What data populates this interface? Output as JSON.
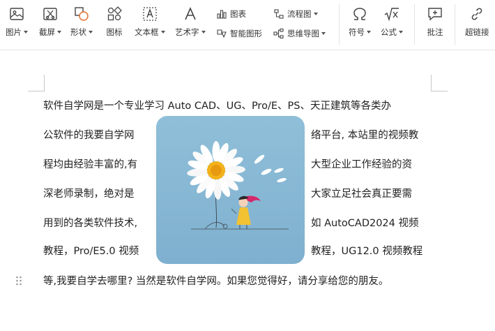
{
  "ribbon": {
    "tools": [
      {
        "id": "picture",
        "label": "图片",
        "icon": "picture-icon",
        "has_dropdown": true
      },
      {
        "id": "screenshot",
        "label": "截屏",
        "icon": "screenshot-icon",
        "has_dropdown": true
      },
      {
        "id": "shape",
        "label": "形状",
        "icon": "shape-icon",
        "has_dropdown": true
      },
      {
        "id": "icon",
        "label": "图标",
        "icon": "icon-library-icon",
        "has_dropdown": false
      },
      {
        "id": "textbox",
        "label": "文本框",
        "icon": "textbox-icon",
        "has_dropdown": true
      },
      {
        "id": "wordart",
        "label": "艺术字",
        "icon": "wordart-icon",
        "has_dropdown": true
      },
      {
        "id": "symbol",
        "label": "符号",
        "icon": "omega-icon",
        "has_dropdown": true
      },
      {
        "id": "formula",
        "label": "公式",
        "icon": "formula-icon",
        "has_dropdown": true
      },
      {
        "id": "comment",
        "label": "批注",
        "icon": "comment-icon",
        "has_dropdown": false
      },
      {
        "id": "hyperlink",
        "label": "超链接",
        "icon": "link-icon",
        "has_dropdown": false
      }
    ],
    "small_tools": [
      {
        "id": "chart",
        "label": "图表",
        "icon": "chart-icon",
        "has_dropdown": false
      },
      {
        "id": "smartart",
        "label": "智能图形",
        "icon": "smartart-icon",
        "has_dropdown": false
      },
      {
        "id": "flowchart",
        "label": "流程图",
        "icon": "flowchart-icon",
        "has_dropdown": true
      },
      {
        "id": "mindmap",
        "label": "思维导图",
        "icon": "mindmap-icon",
        "has_dropdown": true
      }
    ]
  },
  "document": {
    "line1": "软件自学网是一个专业学习 Auto CAD、UG、Pro/E、PS、天正建筑等各类办",
    "line2_left": "公软件的我要自学网",
    "line2_right": "络平台, 本站里的视频教",
    "line3_left": "程均由经验丰富的,有",
    "line3_right": "大型企业工作经验的资",
    "line4_left": "深老师录制，绝对是",
    "line4_right": "大家立足社会真正要需",
    "line5_left": "用到的各类软件技术,",
    "line5_right": "如 AutoCAD2024 视频",
    "line6_left": "教程，Pro/E5.0 视频",
    "line6_right": "教程，UG12.0 视频教程",
    "line7": "等,我要自学去哪里? 当然是软件自学网。如果您觉得好，请分享给您的朋友。"
  },
  "image": {
    "description_icon": "daisy-girl-illustration"
  },
  "colors": {
    "picture_bg": "#8fbcd6",
    "petal": "#ffffff",
    "flower_center": "#f3b21a",
    "dress": "#f2c232",
    "hair": "#d6286a"
  }
}
